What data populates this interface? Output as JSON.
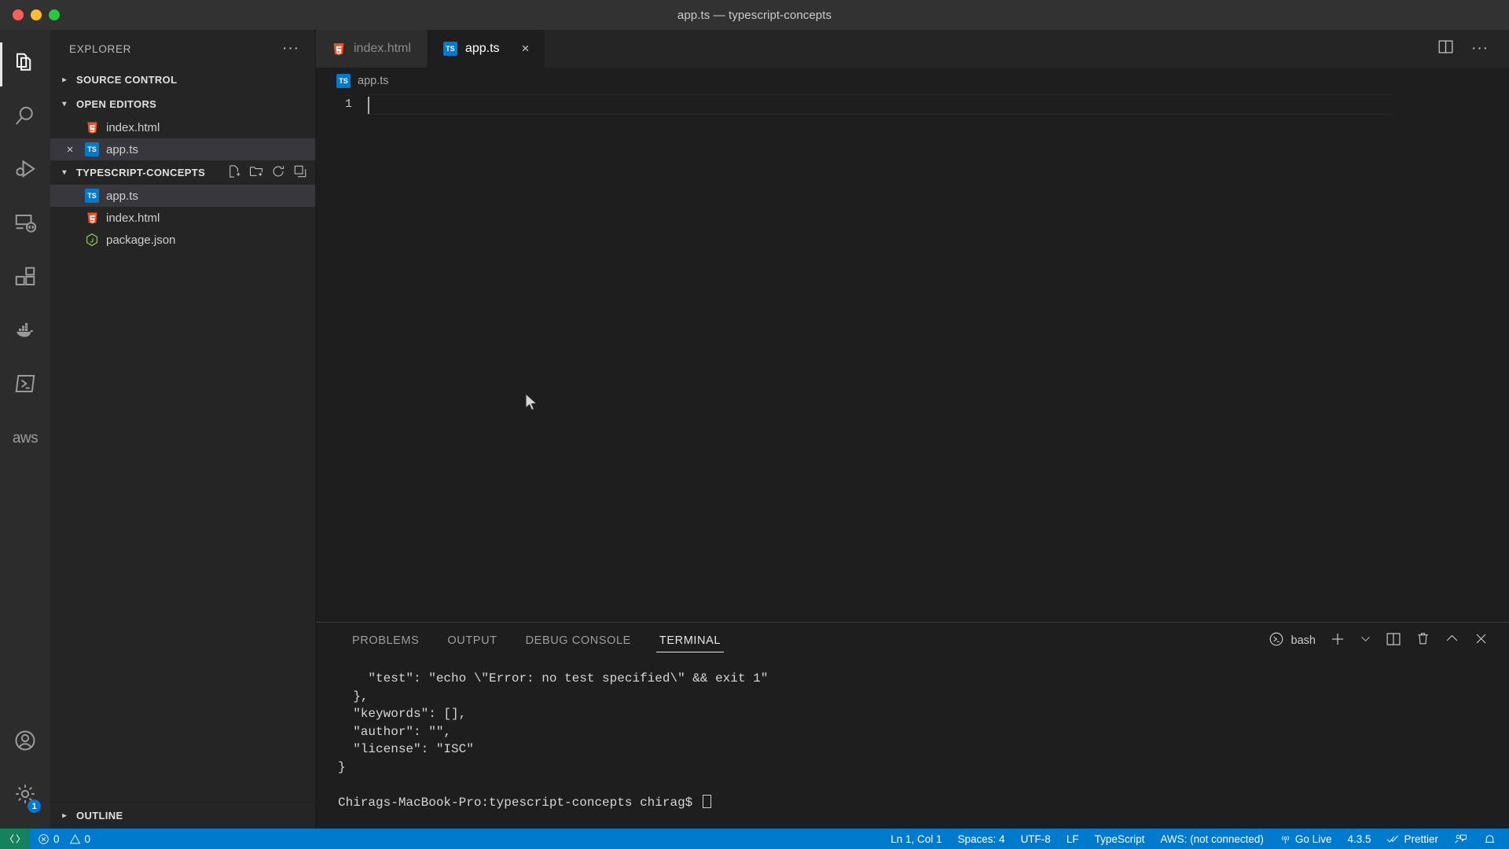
{
  "window": {
    "title": "app.ts — typescript-concepts",
    "traffic_lights": [
      "close",
      "minimize",
      "zoom"
    ]
  },
  "activity_bar": {
    "items": [
      {
        "name": "explorer",
        "icon": "files-icon",
        "active": true
      },
      {
        "name": "search",
        "icon": "search-icon",
        "active": false
      },
      {
        "name": "run-and-debug",
        "icon": "run-debug-icon",
        "active": false
      },
      {
        "name": "remote-explorer",
        "icon": "remote-explorer-icon",
        "active": false
      },
      {
        "name": "extensions",
        "icon": "extensions-icon",
        "active": false
      },
      {
        "name": "docker",
        "icon": "docker-icon",
        "active": false
      },
      {
        "name": "powershell",
        "icon": "powershell-icon",
        "active": false
      },
      {
        "name": "aws-toolkit",
        "icon": "aws-icon",
        "active": false,
        "label": "aws"
      }
    ],
    "bottom_items": [
      {
        "name": "accounts",
        "icon": "account-icon"
      },
      {
        "name": "manage",
        "icon": "gear-icon",
        "badge": "1"
      }
    ]
  },
  "sidebar": {
    "header_title": "EXPLORER",
    "more_actions_label": "···",
    "sections": [
      {
        "name": "source-control",
        "label": "SOURCE CONTROL",
        "expanded": false
      },
      {
        "name": "open-editors",
        "label": "OPEN EDITORS",
        "expanded": true
      },
      {
        "name": "typescript-concepts",
        "label": "TYPESCRIPT-CONCEPTS",
        "expanded": true
      }
    ],
    "open_editors": [
      {
        "name": "index.html",
        "icon": "html5-icon",
        "selected": false,
        "dirty": false
      },
      {
        "name": "app.ts",
        "icon": "typescript-icon",
        "selected": true,
        "close": "×"
      }
    ],
    "folder_files": [
      {
        "name": "app.ts",
        "icon": "typescript-icon",
        "selected": true
      },
      {
        "name": "index.html",
        "icon": "html5-icon",
        "selected": false
      },
      {
        "name": "package.json",
        "icon": "nodejs-icon",
        "selected": false
      }
    ],
    "folder_actions": [
      "new-file-icon",
      "new-folder-icon",
      "refresh-icon",
      "collapse-all-icon"
    ],
    "outline_label": "OUTLINE"
  },
  "editor": {
    "tabs": [
      {
        "label": "index.html",
        "icon": "html5-icon",
        "active": false
      },
      {
        "label": "app.ts",
        "icon": "typescript-icon",
        "active": true,
        "close": "×"
      }
    ],
    "actions": [
      "split-editor-icon",
      "more-actions-icon"
    ],
    "breadcrumb": "app.ts",
    "breadcrumb_icon": "typescript-icon",
    "line_numbers": [
      "1"
    ],
    "code_lines": [
      ""
    ],
    "cursor_position": "Ln 1, Col 1"
  },
  "panel": {
    "tabs": [
      {
        "label": "PROBLEMS",
        "active": false
      },
      {
        "label": "OUTPUT",
        "active": false
      },
      {
        "label": "DEBUG CONSOLE",
        "active": false
      },
      {
        "label": "TERMINAL",
        "active": true
      }
    ],
    "shell": "bash",
    "shell_icon": "terminal-bash-icon",
    "actions": [
      "new-terminal-icon",
      "terminal-dropdown-icon",
      "split-terminal-icon",
      "kill-terminal-icon",
      "maximize-panel-icon",
      "close-panel-icon"
    ],
    "terminal_output": "    \"test\": \"echo \\\"Error: no test specified\\\" && exit 1\"\n  },\n  \"keywords\": [],\n  \"author\": \"\",\n  \"license\": \"ISC\"\n}\n\n",
    "terminal_prompt": "Chirags-MacBook-Pro:typescript-concepts chirag$ "
  },
  "status_bar": {
    "remote_icon": "remote-window-icon",
    "left_items": [
      {
        "name": "errors",
        "icon": "error-icon",
        "value": "0"
      },
      {
        "name": "warnings",
        "icon": "warning-icon",
        "value": "0"
      }
    ],
    "right_items": [
      {
        "name": "cursor-position",
        "label": "Ln 1, Col 1"
      },
      {
        "name": "indentation",
        "label": "Spaces: 4"
      },
      {
        "name": "encoding",
        "label": "UTF-8"
      },
      {
        "name": "eol",
        "label": "LF"
      },
      {
        "name": "language-mode",
        "label": "TypeScript"
      },
      {
        "name": "aws-connection",
        "label": "AWS: (not connected)"
      },
      {
        "name": "go-live",
        "label": "Go Live",
        "icon": "broadcast-icon"
      },
      {
        "name": "version",
        "label": "4.3.5"
      },
      {
        "name": "prettier",
        "label": "Prettier",
        "icon": "check-all-icon"
      },
      {
        "name": "feedback",
        "label": "",
        "icon": "feedback-icon"
      },
      {
        "name": "notifications",
        "label": "",
        "icon": "bell-icon"
      }
    ]
  },
  "colors": {
    "accent": "#007acc",
    "remote_green": "#16825d",
    "titlebar": "#323233",
    "sidebar": "#252526",
    "editor": "#1e1e1e",
    "activitybar": "#2c2c2c",
    "typescript_blue": "#007acc",
    "html_red": "#e44d26",
    "node_green": "#8cc84b"
  }
}
